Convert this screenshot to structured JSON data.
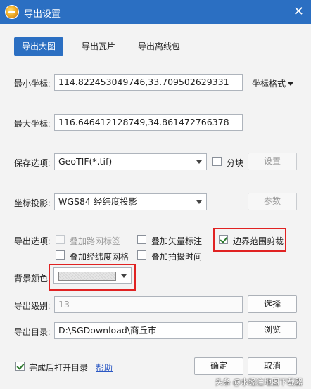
{
  "window": {
    "title": "导出设置"
  },
  "tabs": [
    {
      "label": "导出大图",
      "active": true
    },
    {
      "label": "导出瓦片",
      "active": false
    },
    {
      "label": "导出离线包",
      "active": false
    }
  ],
  "min_coord": {
    "label": "最小坐标:",
    "value": "114.822453049746,33.709502629331"
  },
  "coord_format": {
    "label": "坐标格式"
  },
  "max_coord": {
    "label": "最大坐标:",
    "value": "116.646412128749,34.861472766378"
  },
  "save_option": {
    "label": "保存选项:",
    "value": "GeoTIF(*.tif)",
    "tile_label": "分块",
    "settings_label": "设置"
  },
  "projection": {
    "label": "坐标投影:",
    "value": "WGS84 经纬度投影",
    "params_label": "参数"
  },
  "export_options": {
    "label": "导出选项:",
    "items": [
      {
        "label": "叠加路网标签",
        "checked": false,
        "enabled": false
      },
      {
        "label": "叠加矢量标注",
        "checked": false,
        "enabled": true
      },
      {
        "label": "边界范围剪裁",
        "checked": true,
        "enabled": true
      },
      {
        "label": "叠加经纬度网格",
        "checked": false,
        "enabled": true
      },
      {
        "label": "叠加拍摄时间",
        "checked": false,
        "enabled": true
      }
    ]
  },
  "background": {
    "label": "背景颜色"
  },
  "level": {
    "label": "导出级别:",
    "value": "13",
    "select_label": "选择"
  },
  "directory": {
    "label": "导出目录:",
    "value": "D:\\SGDownload\\商丘市",
    "browse_label": "浏览"
  },
  "footer": {
    "open_after_label": "完成后打开目录",
    "open_after_checked": true,
    "help_label": "帮助",
    "ok_label": "确定",
    "cancel_label": "取消"
  },
  "watermark": "头条 @水经注地图下载器",
  "colors": {
    "titlebar": "#2b6fc2",
    "highlight": "#e02222",
    "link": "#2b58c4"
  }
}
